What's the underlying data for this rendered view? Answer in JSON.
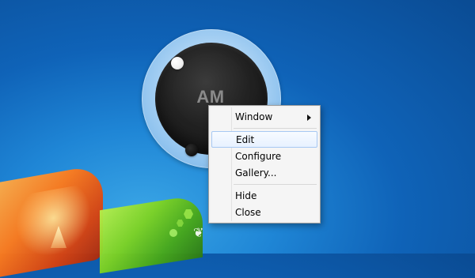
{
  "gadget": {
    "label": "AM"
  },
  "context_menu": {
    "items": [
      {
        "label": "Window",
        "has_submenu": true
      },
      {
        "label": "Edit",
        "highlighted": true
      },
      {
        "label": "Configure"
      },
      {
        "label": "Gallery..."
      },
      {
        "label": "Hide"
      },
      {
        "label": "Close"
      }
    ]
  },
  "colors": {
    "desktop_blue": "#0f63b8",
    "menu_highlight_border": "#a7c8f2",
    "menu_background": "#f2f2f2",
    "gadget_ring": "#8ec2ee"
  },
  "icons": {
    "submenu_indicator": "chevron-right-icon"
  }
}
